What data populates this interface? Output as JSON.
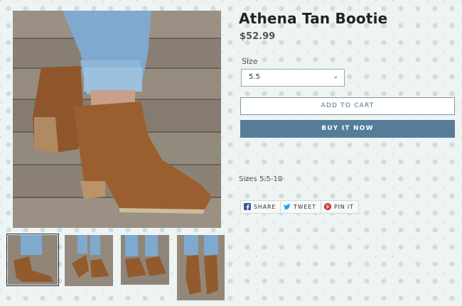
{
  "product": {
    "title": "Athena Tan Bootie",
    "price": "$52.99",
    "size_label": "Size",
    "size_selected": "5.5",
    "add_to_cart_label": "ADD TO CART",
    "buy_now_label": "BUY IT NOW",
    "description": "Sizes 5.5-10"
  },
  "share": {
    "facebook": "SHARE",
    "twitter": "TWEET",
    "pinterest": "PIN IT"
  },
  "icons": {
    "select": "chevron-down-icon",
    "facebook": "facebook-icon",
    "twitter": "twitter-icon",
    "pinterest": "pinterest-icon"
  },
  "colors": {
    "buy_button": "#557d99",
    "add_to_cart_text": "#47728f",
    "facebook": "#3b5998",
    "twitter": "#1da1f2",
    "pinterest": "#cb2027"
  }
}
